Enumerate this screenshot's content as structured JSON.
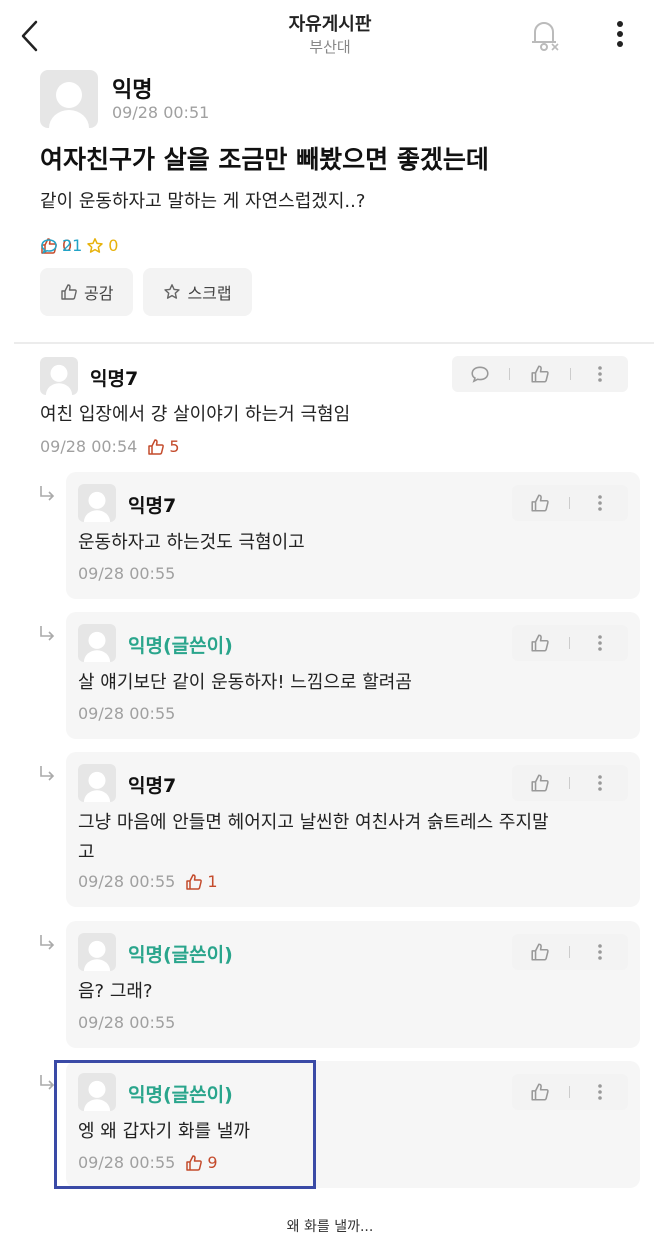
{
  "header": {
    "title": "자유게시판",
    "subtitle": "부산대",
    "icons": {
      "back": "chevron-left-icon",
      "bell": "bell-off-icon",
      "more": "vertical-dots-icon"
    }
  },
  "post": {
    "author": "익명",
    "time": "09/28 00:51",
    "title": "여자친구가 살을 조금만 빼봤으면 좋겠는데",
    "body": "같이 운동하자고 말하는 게 자연스럽겠지..?",
    "stats": {
      "likes": "0",
      "comments": "21",
      "scraps": "0"
    },
    "actions": {
      "like_label": "공감",
      "scrap_label": "스크랩"
    }
  },
  "comments": [
    {
      "author": "익명7",
      "text": "여친 입장에서 걍 살이야기 하는거 극혐임",
      "time": "09/28 00:54",
      "likes": "5",
      "op": false,
      "reply": false
    },
    {
      "author": "익명7",
      "text": "운동하자고 하는것도 극혐이고",
      "time": "09/28 00:55",
      "likes": "",
      "op": false,
      "reply": true
    },
    {
      "author": "익명(글쓴이)",
      "text": "살 얘기보단 같이 운동하자! 느낌으로 할려곰",
      "time": "09/28 00:55",
      "likes": "",
      "op": true,
      "reply": true
    },
    {
      "author": "익명7",
      "text": "그냥 마음에 안들면 헤어지고 날씬한 여친사겨 슭트레스 주지말\n고",
      "time": "09/28 00:55",
      "likes": "1",
      "op": false,
      "reply": true
    },
    {
      "author": "익명(글쓴이)",
      "text": "음? 그래?",
      "time": "09/28 00:55",
      "likes": "",
      "op": true,
      "reply": true
    },
    {
      "author": "익명(글쓴이)",
      "text": "엥 왜 갑자기 화를 낼까",
      "time": "09/28 00:55",
      "likes": "9",
      "op": true,
      "reply": true
    }
  ],
  "caption": "왜 화를 낼까...",
  "colors": {
    "like": "#c44b2c",
    "comment": "#23a3c7",
    "scrap": "#e7b20b",
    "op_author": "#2aa58c",
    "highlight": "#3a4aa6"
  }
}
